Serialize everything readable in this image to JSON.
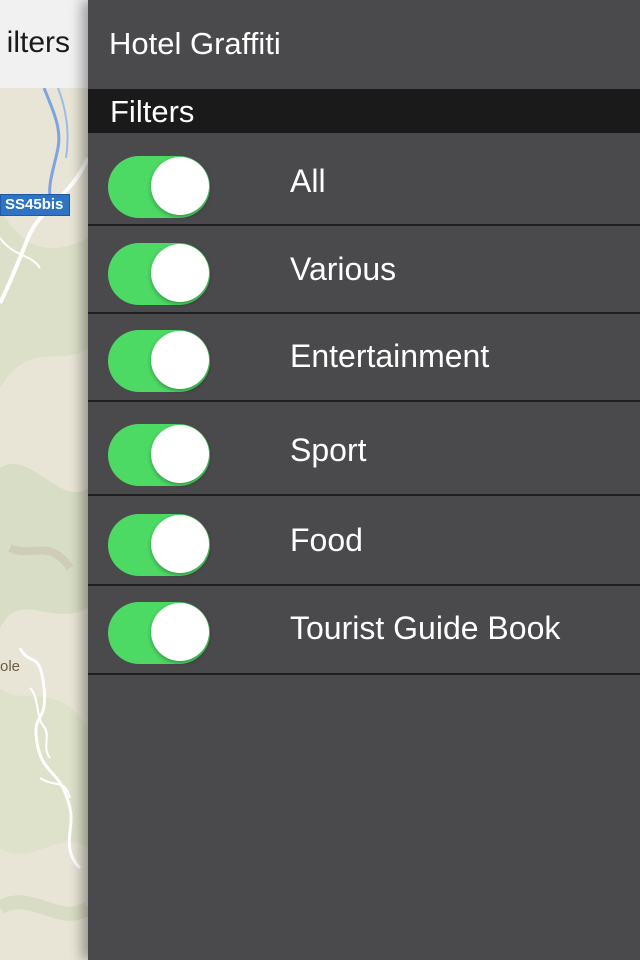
{
  "map": {
    "back_title": "ilters",
    "road_shield": "SS45bis",
    "place_label": "ole"
  },
  "drawer": {
    "title": "Hotel Graffiti",
    "section_label": "Filters",
    "filters": [
      {
        "label": "All",
        "enabled": true
      },
      {
        "label": "Various",
        "enabled": true
      },
      {
        "label": "Entertainment",
        "enabled": true
      },
      {
        "label": "Sport",
        "enabled": true
      },
      {
        "label": "Food",
        "enabled": true
      },
      {
        "label": "Tourist Guide Book",
        "enabled": true
      }
    ]
  },
  "colors": {
    "toggle_on": "#4cd964",
    "drawer_bg": "#4a4a4c",
    "section_bg": "#1a1a1a",
    "road_shield": "#2f73c5"
  }
}
